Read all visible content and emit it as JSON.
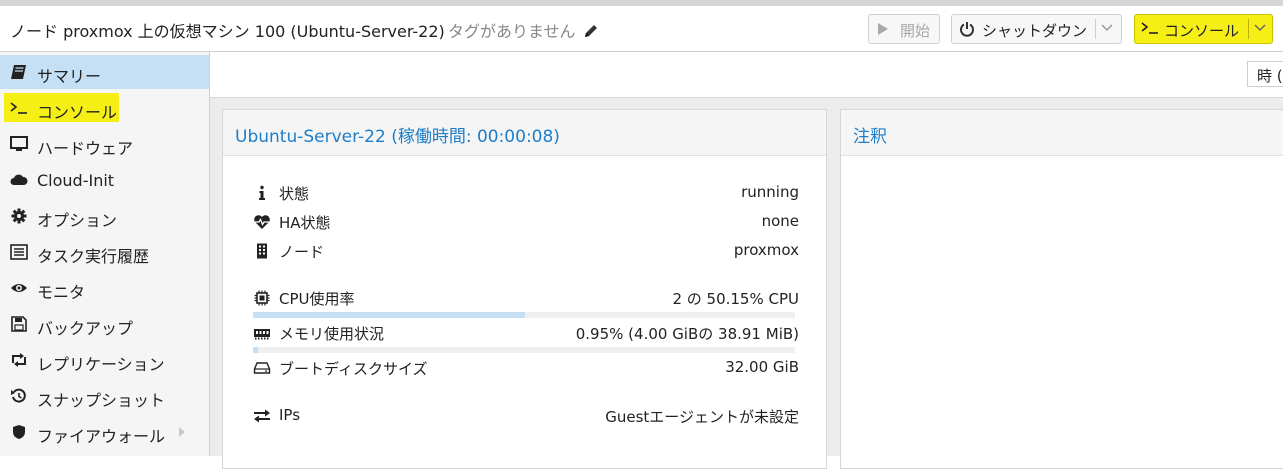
{
  "header": {
    "title": "ノード proxmox 上の仮想マシン 100 (Ubuntu-Server-22)",
    "tags": "タグがありません",
    "buttons": {
      "start": "開始",
      "shutdown": "シャットダウン",
      "console": "コンソール"
    }
  },
  "sidebar": {
    "items": [
      {
        "label": "サマリー",
        "icon": "book-icon",
        "state": "active"
      },
      {
        "label": "コンソール",
        "icon": "terminal-icon",
        "state": "highlighted"
      },
      {
        "label": "ハードウェア",
        "icon": "monitor-icon"
      },
      {
        "label": "Cloud-Init",
        "icon": "cloud-icon"
      },
      {
        "label": "オプション",
        "icon": "gear-icon"
      },
      {
        "label": "タスク実行履歴",
        "icon": "list-icon"
      },
      {
        "label": "モニタ",
        "icon": "eye-icon"
      },
      {
        "label": "バックアップ",
        "icon": "floppy-icon"
      },
      {
        "label": "レプリケーション",
        "icon": "retweet-icon"
      },
      {
        "label": "スナップショット",
        "icon": "history-icon"
      },
      {
        "label": "ファイアウォール",
        "icon": "shield-icon",
        "expandable": true
      }
    ]
  },
  "toolbar": {
    "timeframe": "時 ("
  },
  "status_panel": {
    "title": "Ubuntu-Server-22 (稼働時間: 00:00:08)",
    "rows": [
      {
        "label": "状態",
        "value": "running",
        "icon": "info-icon"
      },
      {
        "label": "HA状態",
        "value": "none",
        "icon": "heartbeat-icon"
      },
      {
        "label": "ノード",
        "value": "proxmox",
        "icon": "building-icon"
      },
      {
        "label": "CPU使用率",
        "value": "2 の 50.15% CPU",
        "icon": "cpu-icon",
        "progress": 0.5015
      },
      {
        "label": "メモリ使用状況",
        "value": "0.95% (4.00 GiBの 38.91 MiB)",
        "icon": "memory-icon",
        "progress": 0.0095
      },
      {
        "label": "ブートディスクサイズ",
        "value": "32.00 GiB",
        "icon": "hdd-icon"
      },
      {
        "label": "IPs",
        "value": "Guestエージェントが未設定",
        "icon": "exchange-icon"
      }
    ]
  },
  "notes_panel": {
    "title": "注釈"
  },
  "colors": {
    "accent_blue": "#1d7ec8",
    "active_nav": "#c5dff4",
    "highlight_yellow": "#f5ef16"
  }
}
